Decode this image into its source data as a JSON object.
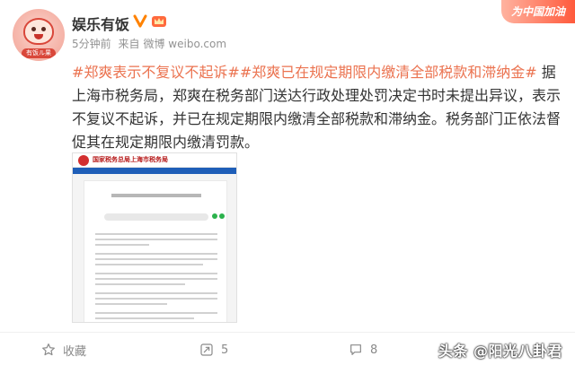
{
  "post": {
    "author": "娱乐有饭",
    "time": "5分钟前",
    "source_prefix": "来自",
    "source": "微博 weibo.com",
    "promo_text": "为中国加油",
    "avatar_badge": "有饭ル果",
    "tag1": "#郑爽表示不复议不起诉#",
    "tag2": "#郑爽已在规定期限内缴清全部税款和滞纳金#",
    "body": "据上海市税务局，郑爽在税务部门送达行政处理处罚决定书时未提出异议，表示不复议不起诉，并已在规定期限内缴清全部税款和滞纳金。税务部门正依法督促其在规定期限内缴清罚款。"
  },
  "attachment": {
    "site_title": "国家税务总局上海市税务局"
  },
  "actions": {
    "favorite_label": "收藏",
    "repost_count": "5",
    "comment_count": "8"
  },
  "watermark": "头条 @阳光八卦君",
  "colors": {
    "tag": "#eb7350",
    "verified": "#ff8200",
    "promo": "#ff5a3c"
  },
  "icons": [
    "verified-icon",
    "crown-icon",
    "star-icon",
    "repost-icon",
    "comment-icon"
  ]
}
